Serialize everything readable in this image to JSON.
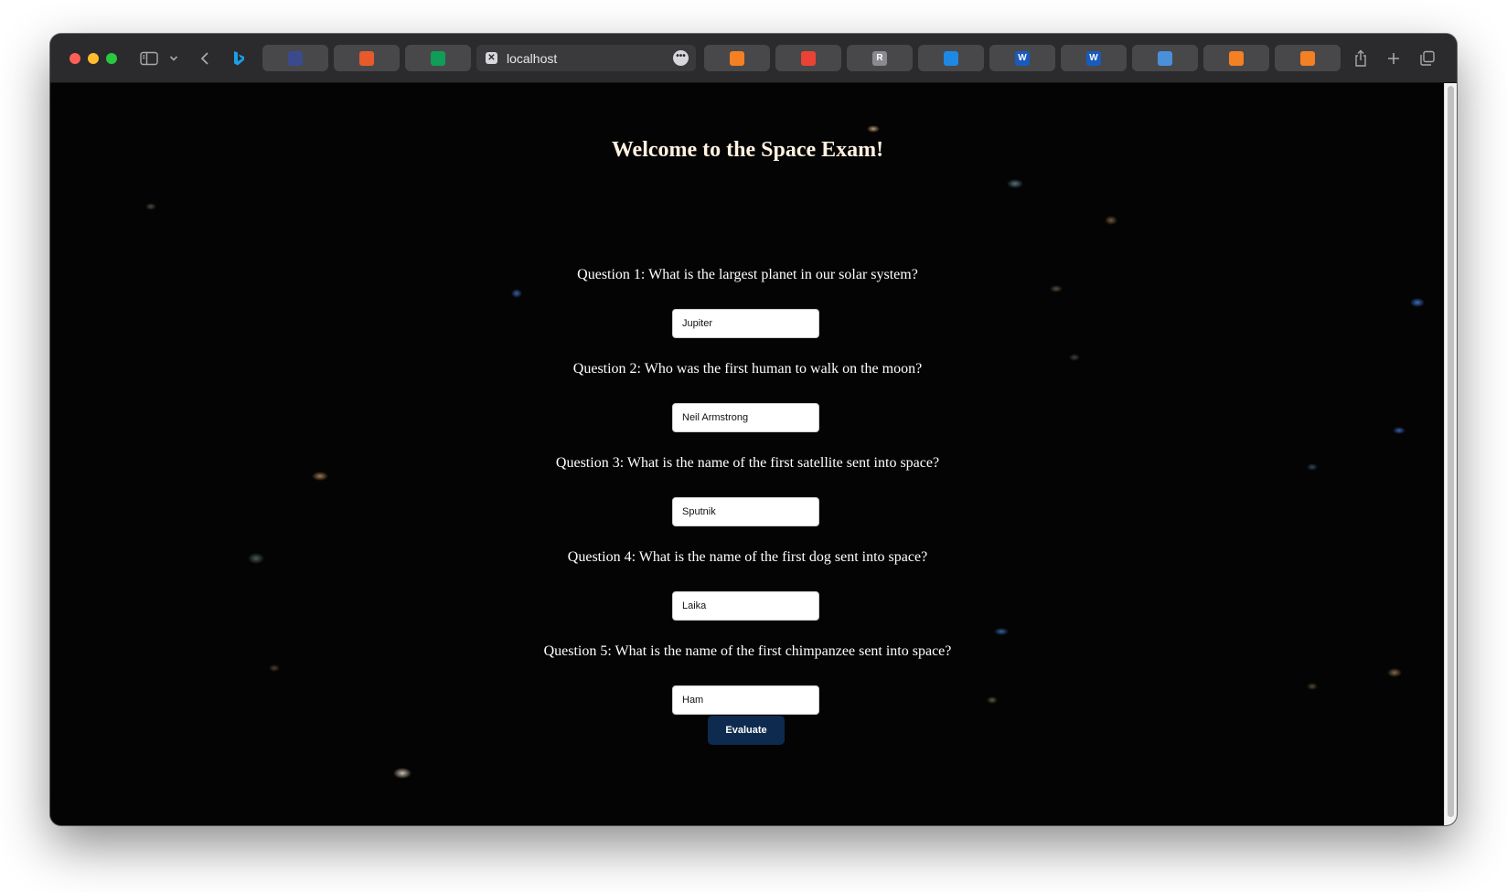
{
  "browser": {
    "tabs": [
      {
        "icon": "document-list-icon",
        "color": "#3b4a8c"
      },
      {
        "icon": "colorful-app-icon",
        "color": "#e85a2c"
      },
      {
        "icon": "sheets-icon",
        "color": "#0f9d58"
      },
      {
        "active": true,
        "title": "localhost"
      },
      {
        "icon": "stackoverflow-icon",
        "color": "#f48024"
      },
      {
        "icon": "gmail-icon",
        "color": "#ea4335"
      },
      {
        "icon": "r-icon",
        "color": "#8a8a90",
        "glyph": "R"
      },
      {
        "icon": "onedrive-icon",
        "color": "#1e88e5"
      },
      {
        "icon": "word-icon",
        "color": "#185abd",
        "glyph": "W"
      },
      {
        "icon": "word-icon",
        "color": "#185abd",
        "glyph": "W"
      },
      {
        "icon": "magnifier-icon",
        "color": "#4a90d9"
      },
      {
        "icon": "stackoverflow-icon",
        "color": "#f48024"
      },
      {
        "icon": "stackoverflow-icon",
        "color": "#f48024"
      }
    ]
  },
  "page": {
    "title": "Welcome to the Space Exam!",
    "questions": [
      {
        "text": "Question 1: What is the largest planet in our solar system?",
        "answer": "Jupiter"
      },
      {
        "text": "Question 2: Who was the first human to walk on the moon?",
        "answer": "Neil Armstrong"
      },
      {
        "text": "Question 3: What is the name of the first satellite sent into space?",
        "answer": "Sputnik"
      },
      {
        "text": "Question 4: What is the name of the first dog sent into space?",
        "answer": "Laika"
      },
      {
        "text": "Question 5: What is the name of the first chimpanzee sent into space?",
        "answer": "Ham"
      }
    ],
    "evaluate_label": "Evaluate"
  }
}
